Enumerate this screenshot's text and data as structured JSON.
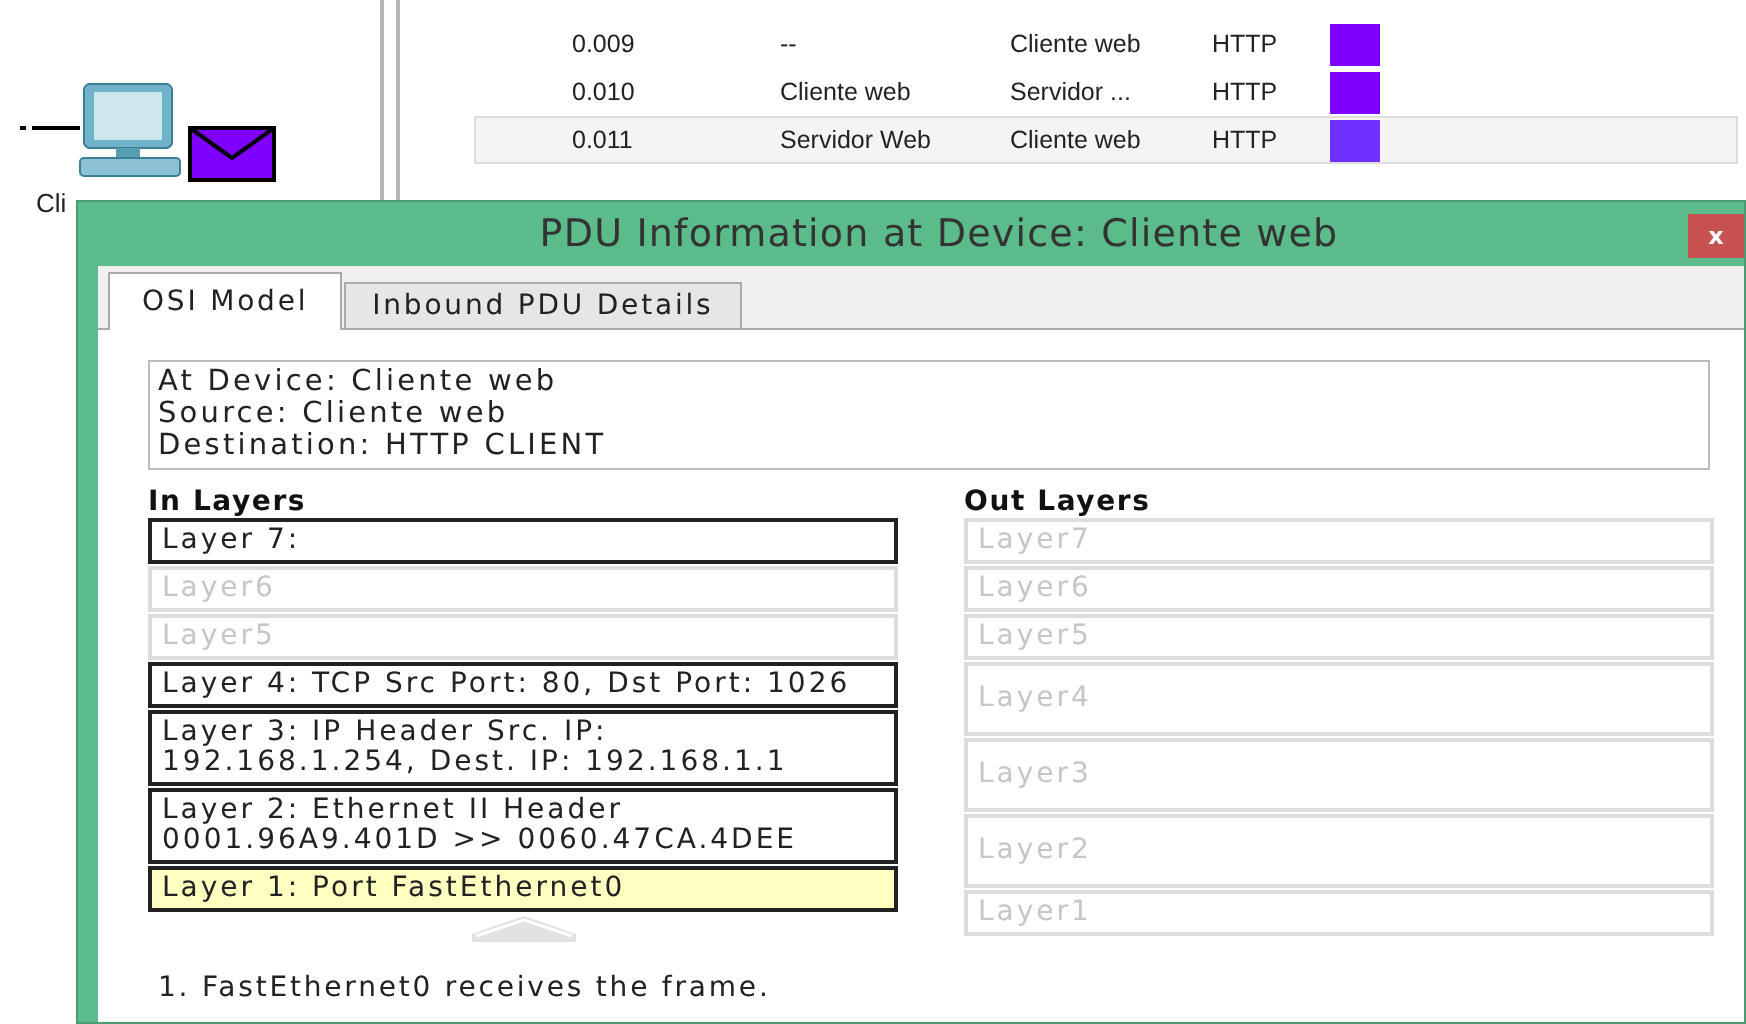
{
  "device": {
    "label": "Cli"
  },
  "events": [
    {
      "time": "0.009",
      "last_device": "--",
      "at_device": "Cliente web",
      "type": "HTTP",
      "color": "#8000ff",
      "selected": false
    },
    {
      "time": "0.010",
      "last_device": "Cliente web",
      "at_device": "Servidor ...",
      "type": "HTTP",
      "color": "#8000ff",
      "selected": false
    },
    {
      "time": "0.011",
      "last_device": "Servidor Web",
      "at_device": "Cliente web",
      "type": "HTTP",
      "color": "#7030ff",
      "selected": true
    }
  ],
  "dialog": {
    "title": "PDU Information at Device: Cliente web",
    "close": "x",
    "tabs": [
      {
        "label": "OSI Model",
        "selected": true
      },
      {
        "label": "Inbound PDU Details",
        "selected": false
      }
    ],
    "info": [
      "At Device: Cliente web",
      "Source: Cliente web",
      "Destination: HTTP CLIENT"
    ],
    "in_layers": {
      "heading": "In Layers",
      "layers": [
        {
          "text": "Layer 7:",
          "kind": "active",
          "selected": false
        },
        {
          "text": "Layer6",
          "kind": "inactive",
          "selected": false
        },
        {
          "text": "Layer5",
          "kind": "inactive",
          "selected": false
        },
        {
          "text": "Layer 4: TCP Src Port: 80, Dst Port: 1026",
          "kind": "active",
          "selected": false
        },
        {
          "text": "Layer 3: IP Header Src. IP: 192.168.1.254, Dest. IP: 192.168.1.1",
          "kind": "active",
          "selected": false
        },
        {
          "text": "Layer 2: Ethernet II Header 0001.96A9.401D >> 0060.47CA.4DEE",
          "kind": "active",
          "selected": false
        },
        {
          "text": "Layer 1: Port FastEthernet0",
          "kind": "active",
          "selected": true
        }
      ]
    },
    "out_layers": {
      "heading": "Out Layers",
      "layers": [
        {
          "text": "Layer7",
          "kind": "inactive",
          "selected": false,
          "tall": false
        },
        {
          "text": "Layer6",
          "kind": "inactive",
          "selected": false,
          "tall": false
        },
        {
          "text": "Layer5",
          "kind": "inactive",
          "selected": false,
          "tall": false
        },
        {
          "text": "Layer4",
          "kind": "inactive",
          "selected": false,
          "tall": true
        },
        {
          "text": "Layer3",
          "kind": "inactive",
          "selected": false,
          "tall": true
        },
        {
          "text": "Layer2",
          "kind": "inactive",
          "selected": false,
          "tall": true
        },
        {
          "text": "Layer1",
          "kind": "inactive",
          "selected": false,
          "tall": false
        }
      ]
    },
    "steps": [
      "1. FastEthernet0 receives the frame."
    ]
  }
}
